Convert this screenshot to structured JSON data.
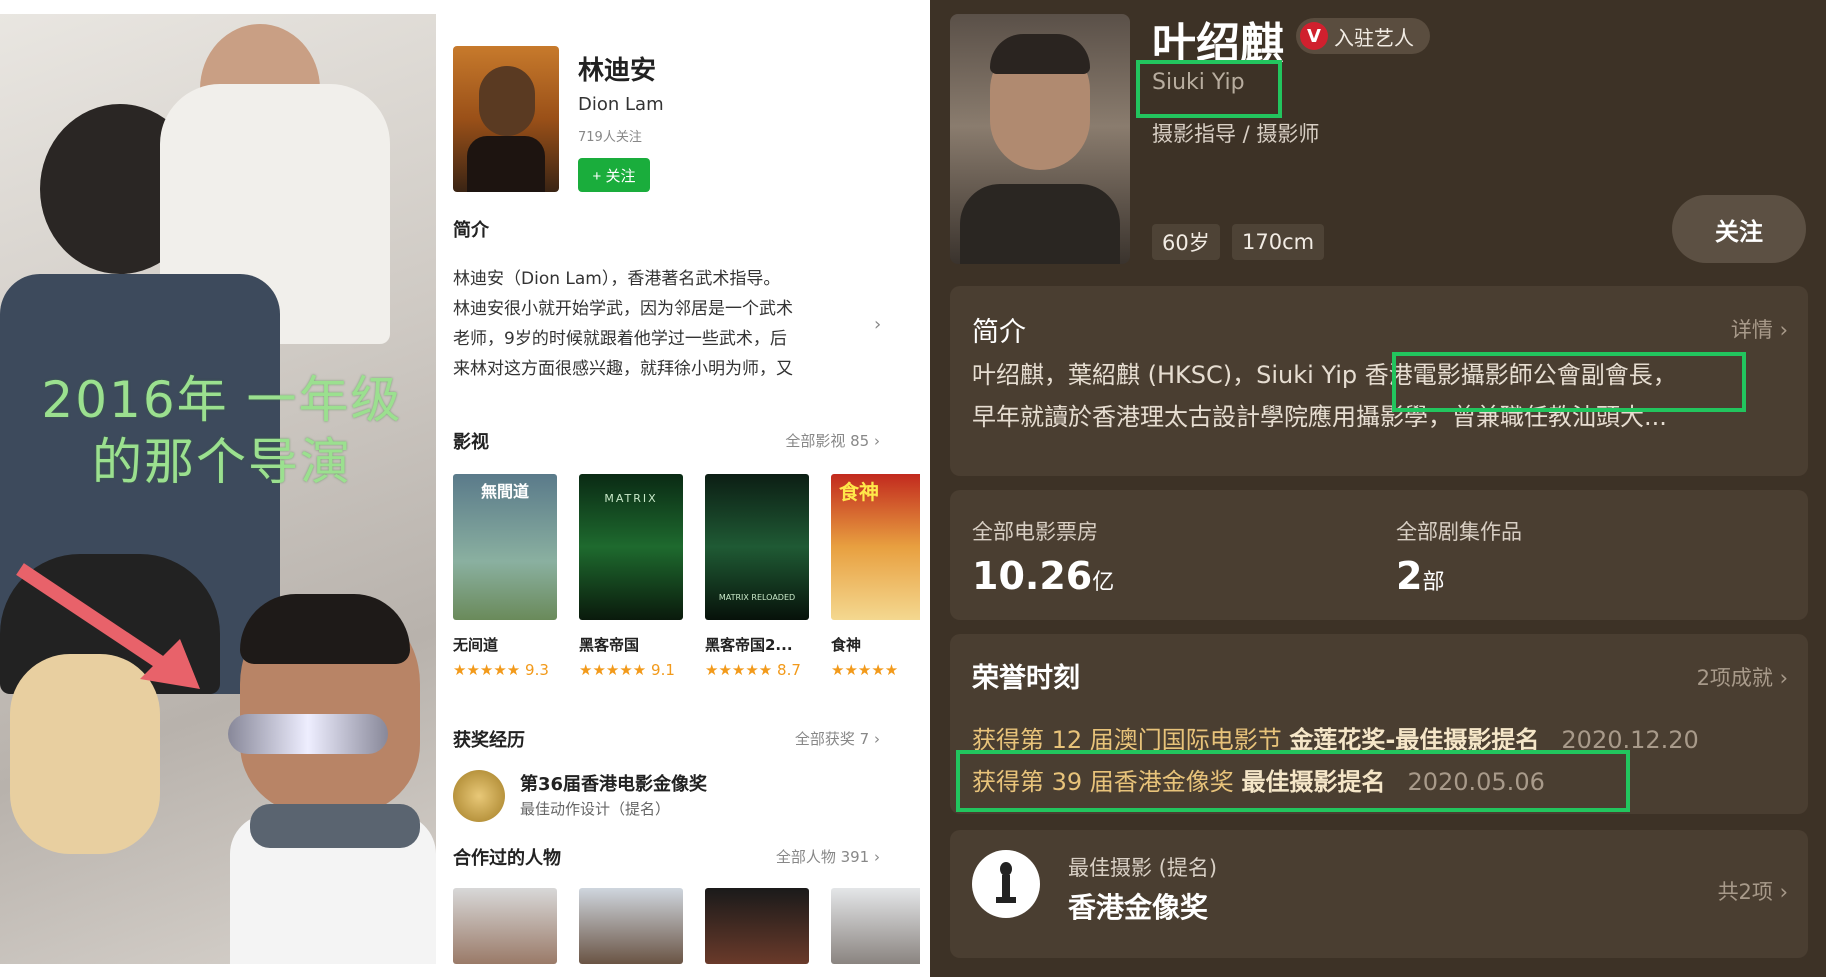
{
  "photo": {
    "caption_line1": "2016年 一年级",
    "caption_line2": "的那个导演"
  },
  "left_app": {
    "name": "林迪安",
    "english_name": "Dion Lam",
    "fans": "719人关注",
    "follow_label": "+ 关注",
    "intro_title": "简介",
    "intro_lines": [
      "林迪安（Dion Lam），香港著名武术指导。",
      "林迪安很小就开始学武，因为邻居是一个武术",
      "老师，9岁的时候就跟着他学过一些武术，后",
      "来林对这方面很感兴趣，就拜徐小明为师，又"
    ],
    "films_title": "影视",
    "films_more": "全部影视 85",
    "films": [
      {
        "title": "无间道",
        "stars": "★★★★★",
        "score": "9.3"
      },
      {
        "title": "黑客帝国",
        "stars": "★★★★★",
        "score": "9.1"
      },
      {
        "title": "黑客帝国2...",
        "stars": "★★★★★",
        "score": "8.7"
      },
      {
        "title": "食神",
        "stars": "★★★★★",
        "score": ""
      }
    ],
    "poster_text": [
      "無間道",
      "MATRIX",
      "MATRIX RELOADED",
      "食神"
    ],
    "awards_title": "获奖经历",
    "awards_more": "全部获奖 7",
    "award_name": "第36届香港电影金像奖",
    "award_sub": "最佳动作设计（提名）",
    "collab_title": "合作过的人物",
    "collab_more": "全部人物 391"
  },
  "right_app": {
    "name": "叶绍麒",
    "badge_v": "V",
    "badge_label": "入驻艺人",
    "english_name": "Siuki Yip",
    "roles": "摄影指导 / 摄影师",
    "age": "60岁",
    "height": "170cm",
    "follow_label": "关注",
    "intro_title": "简介",
    "intro_more": "详情 ›",
    "intro_line1_a": "叶绍麒，葉紹麒 (HKSC)，Siuki Yip ",
    "intro_line1_b": "香港電影攝影師公會副會長，",
    "intro_line2": "早年就讀於香港理太古設計學院應用攝影學，曾兼職任教汕頭大...",
    "box_office_label": "全部电影票房",
    "box_office_value": "10.26",
    "box_office_unit": "亿",
    "series_label": "全部剧集作品",
    "series_value": "2",
    "series_unit": "部",
    "honor_title": "荣誉时刻",
    "honor_more": "2项成就 ›",
    "honors": [
      {
        "prefix": "获得第 12 届澳门国际电影节 ",
        "award": "金莲花奖-最佳摄影提名",
        "date": "2020.12.20"
      },
      {
        "prefix": "获得第 39 届香港金像奖 ",
        "award": "最佳摄影提名",
        "date": "2020.05.06"
      }
    ],
    "award_card_sub": "最佳摄影 (提名)",
    "award_card_title": "香港金像奖",
    "award_card_more": "共2项 ›"
  },
  "colors": {
    "green_highlight": "#22c55e",
    "follow_green": "#1aad3c",
    "dark_bg": "#3d3226",
    "gold_text": "#e8c37a"
  }
}
